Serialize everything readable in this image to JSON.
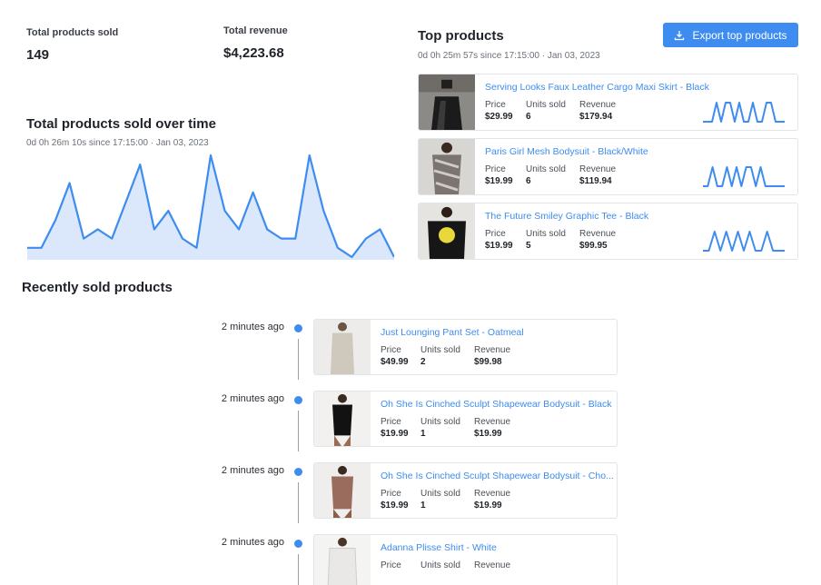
{
  "stats": {
    "sold_label": "Total products sold",
    "sold_value": "149",
    "revenue_label": "Total revenue",
    "revenue_value": "$4,223.68"
  },
  "over_time": {
    "title": "Total products sold over time",
    "subtitle": "0d 0h 26m 10s since 17:15:00 · Jan 03, 2023"
  },
  "chart_data": {
    "type": "area",
    "title": "Total products sold over time",
    "x": [
      1,
      2,
      3,
      4,
      5,
      6,
      7,
      8,
      9,
      10,
      11,
      12,
      13,
      14,
      15,
      16,
      17,
      18,
      19,
      20,
      21,
      22,
      23,
      24,
      25,
      26,
      27
    ],
    "values": [
      1,
      1,
      4,
      8,
      2,
      3,
      2,
      6,
      10,
      3,
      5,
      2,
      1,
      11,
      5,
      3,
      7,
      3,
      2,
      2,
      11,
      5,
      1,
      0,
      2,
      3,
      0
    ],
    "series_color": "#3e8cf0",
    "fill_color": "#dbe8fb",
    "ylim": [
      0,
      11
    ],
    "grid": false
  },
  "top": {
    "title": "Top products",
    "subtitle": "0d 0h 25m 57s since 17:15:00 · Jan 03, 2023",
    "export_label": "Export top products",
    "export_icon": "download-icon",
    "price_label": "Price",
    "units_label": "Units sold",
    "revenue_label": "Revenue",
    "items": [
      {
        "name": "Serving Looks Faux Leather Cargo Maxi Skirt - Black",
        "price": "$29.99",
        "units": "6",
        "revenue": "$179.94",
        "spark": [
          0,
          0,
          0,
          1,
          0,
          1,
          1,
          0,
          1,
          0,
          0,
          1,
          0,
          0,
          1,
          1,
          0,
          0,
          0
        ]
      },
      {
        "name": "Paris Girl Mesh Bodysuit - Black/White",
        "price": "$19.99",
        "units": "6",
        "revenue": "$119.94",
        "spark": [
          0,
          0,
          1,
          0,
          0,
          1,
          0,
          1,
          0,
          1,
          1,
          0,
          1,
          0,
          0,
          0,
          0,
          0
        ]
      },
      {
        "name": "The Future Smiley Graphic Tee - Black",
        "price": "$19.99",
        "units": "5",
        "revenue": "$99.95",
        "spark": [
          0,
          0,
          1,
          0,
          1,
          0,
          1,
          0,
          1,
          0,
          0,
          1,
          0,
          0,
          0
        ]
      }
    ]
  },
  "recent": {
    "title": "Recently sold products",
    "price_label": "Price",
    "units_label": "Units sold",
    "revenue_label": "Revenue",
    "items": [
      {
        "time": "2 minutes ago",
        "name": "Just Lounging Pant Set - Oatmeal",
        "price": "$49.99",
        "units": "2",
        "revenue": "$99.98"
      },
      {
        "time": "2 minutes ago",
        "name": "Oh She Is Cinched Sculpt Shapewear Bodysuit - Black",
        "price": "$19.99",
        "units": "1",
        "revenue": "$19.99"
      },
      {
        "time": "2 minutes ago",
        "name": "Oh She Is Cinched Sculpt Shapewear Bodysuit - Cho...",
        "price": "$19.99",
        "units": "1",
        "revenue": "$19.99"
      },
      {
        "time": "2 minutes ago",
        "name": "Adanna Plisse Shirt - White",
        "price": "",
        "units": "",
        "revenue": ""
      }
    ]
  }
}
